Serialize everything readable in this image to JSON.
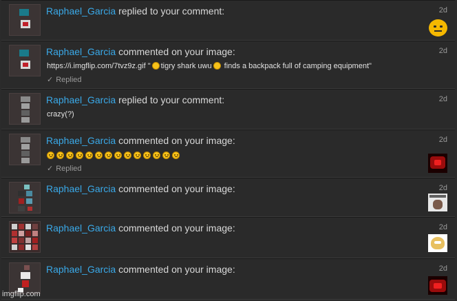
{
  "watermark": "imgflip.com",
  "notifications": [
    {
      "user": "Raphael_Garcia",
      "action": "replied to your comment:",
      "time": "2d",
      "text": "",
      "replied": "",
      "avatar_icon": "smiley-face-avatar"
    },
    {
      "user": "Raphael_Garcia",
      "action": "commented on your image:",
      "time": "2d",
      "text_before": "https://i.imgflip.com/7tvz9z.gif \"",
      "text_mid": "tigry shark uwu",
      "text_after": "finds a backpack full of camping equipment\"",
      "replied": "Replied",
      "avatar_icon": ""
    },
    {
      "user": "Raphael_Garcia",
      "action": "replied to your comment:",
      "time": "2d",
      "text": "crazy(?)",
      "replied": "",
      "avatar_icon": ""
    },
    {
      "user": "Raphael_Garcia",
      "action": "commented on your image:",
      "time": "2d",
      "emoji_count": 14,
      "replied": "Replied",
      "avatar_icon": "red-meme-avatar"
    },
    {
      "user": "Raphael_Garcia",
      "action": "commented on your image:",
      "time": "2d",
      "text": "",
      "replied": "",
      "avatar_icon": "meme-face-avatar"
    },
    {
      "user": "Raphael_Garcia",
      "action": "commented on your image:",
      "time": "2d",
      "text": "",
      "replied": "",
      "avatar_icon": "cartoon-avatar"
    },
    {
      "user": "Raphael_Garcia",
      "action": "commented on your image:",
      "time": "2d",
      "text": "",
      "replied": "",
      "avatar_icon": "red-meme-avatar"
    }
  ],
  "replied_check": "✓"
}
